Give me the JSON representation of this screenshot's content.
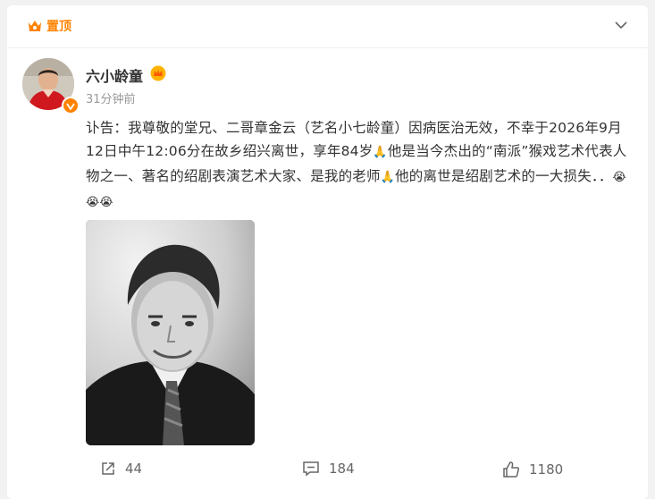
{
  "pin": {
    "label": "置顶",
    "icon": "pin-flame-icon"
  },
  "post": {
    "username": "六小龄童",
    "time": "31分钟前",
    "content_segments": [
      "讣告：我尊敬的堂兄、二哥章金云（艺名小七龄童）因病医治无效，不幸于2026年9月12日中午12:06分在故乡绍兴离世，享年84岁",
      "🙏",
      "他是当今杰出的“南派”猴戏艺术代表人物之一、著名的绍剧表演艺术大家、是我的老师",
      "🙏",
      "他的离世是绍剧艺术的一大损失．．",
      "😭😭😭"
    ]
  },
  "footer": {
    "share_count": "44",
    "comment_count": "184",
    "like_count": "1180"
  },
  "colors": {
    "accent": "#ff8200",
    "text": "#333333",
    "muted": "#999999"
  }
}
